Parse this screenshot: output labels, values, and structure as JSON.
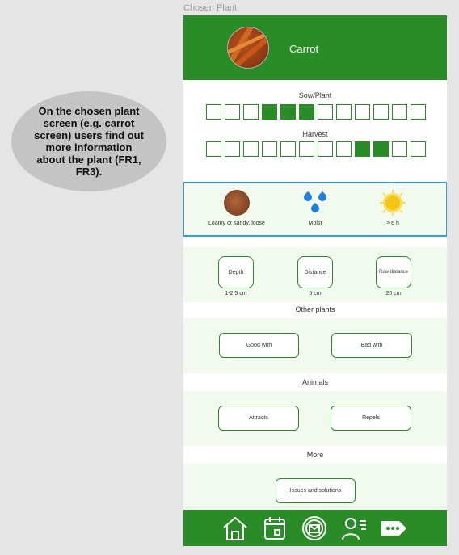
{
  "frame_label": "Chosen Plant",
  "annotation": "On the chosen plant screen (e.g. carrot screen) users find out more information about the plant (FR1, FR3).",
  "plant": {
    "name": "Carrot",
    "image": "carrot-photo"
  },
  "calendar": {
    "sow_label": "Sow/Plant",
    "sow_months": [
      0,
      0,
      0,
      1,
      1,
      1,
      0,
      0,
      0,
      0,
      0,
      0
    ],
    "harvest_label": "Harvest",
    "harvest_months": [
      0,
      0,
      0,
      0,
      0,
      0,
      0,
      0,
      1,
      1,
      0,
      0
    ]
  },
  "conditions": {
    "soil": {
      "icon": "soil-icon",
      "label": "Loamy or sandy, loose"
    },
    "water": {
      "icon": "water-drops-icon",
      "label": "Moist"
    },
    "sun": {
      "icon": "sun-icon",
      "label": "> 6 h"
    }
  },
  "planting": {
    "depth": {
      "label": "Depth",
      "value": "1-2.5 cm"
    },
    "distance": {
      "label": "Distance",
      "value": "5 cm"
    },
    "row_distance": {
      "label": "Row distance",
      "value": "20 cm"
    }
  },
  "other_plants": {
    "heading": "Other plants",
    "good_label": "Good with",
    "bad_label": "Bad with"
  },
  "animals": {
    "heading": "Animals",
    "attracts_label": "Attracts",
    "repels_label": "Repels"
  },
  "more": {
    "heading": "More",
    "issues_label": "Issues and solutions"
  },
  "nav": {
    "accent": "#2a8c26",
    "items": [
      "home-icon",
      "calendar-icon",
      "mail-icon",
      "profile-list-icon",
      "more-tag-icon"
    ]
  }
}
